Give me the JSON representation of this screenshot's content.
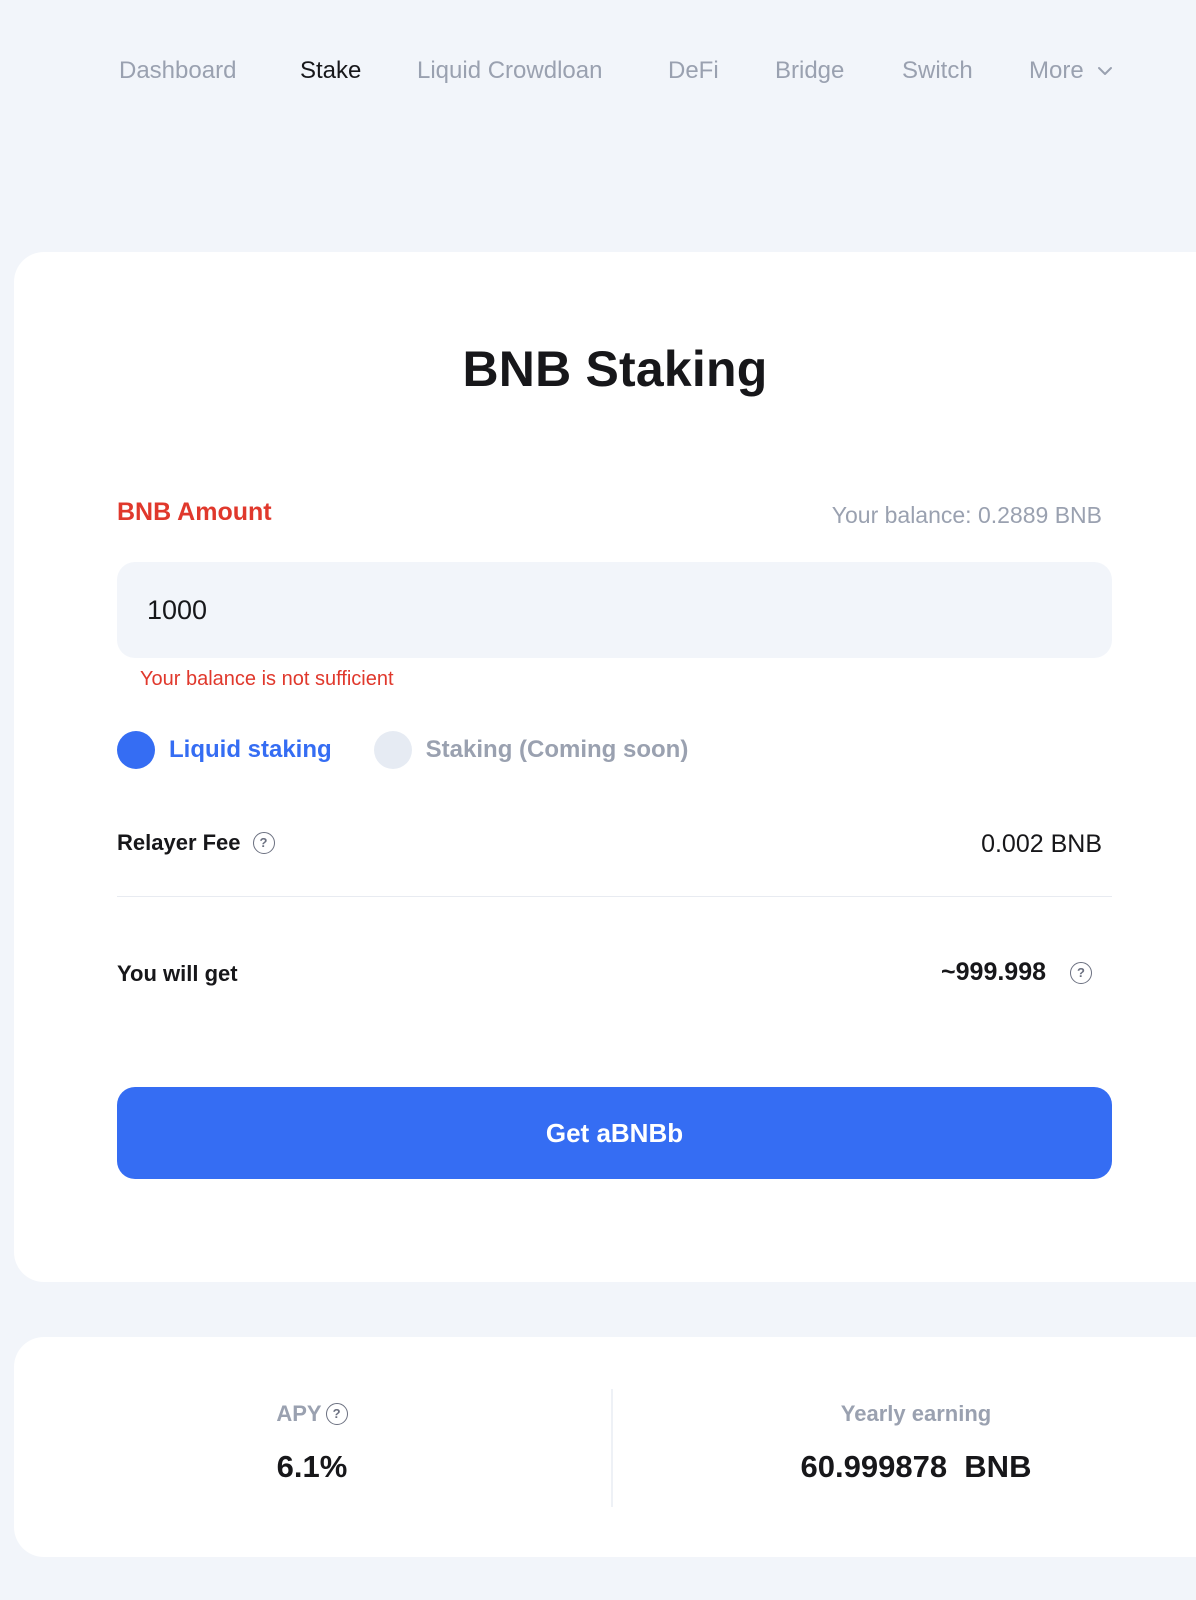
{
  "nav": {
    "items": [
      {
        "label": "Dashboard",
        "active": false
      },
      {
        "label": "Stake",
        "active": true
      },
      {
        "label": "Liquid Crowdloan",
        "active": false
      },
      {
        "label": "DeFi",
        "active": false
      },
      {
        "label": "Bridge",
        "active": false
      },
      {
        "label": "Switch",
        "active": false
      },
      {
        "label": "More",
        "active": false
      }
    ]
  },
  "staking": {
    "title": "BNB Staking",
    "amount_label": "BNB Amount",
    "balance_text": "Your balance: 0.2889 BNB",
    "amount_value": "1000",
    "error_text": "Your balance is not sufficient",
    "options": [
      {
        "label": "Liquid staking",
        "selected": true
      },
      {
        "label": "Staking (Coming soon)",
        "selected": false
      }
    ],
    "fee_label": "Relayer Fee",
    "fee_value": "0.002 BNB",
    "get_label": "You will get",
    "get_value": "~999.998",
    "help_glyph": "?",
    "cta_label": "Get aBNBb"
  },
  "stats": {
    "apy_label": "APY",
    "apy_value": "6.1%",
    "yearly_label": "Yearly earning",
    "yearly_value": "60.999878  BNB"
  },
  "colors": {
    "accent": "#356df3",
    "error": "#e0382c",
    "muted": "#9aa1b0",
    "background": "#f2f5fa"
  },
  "icons": {
    "more": "chevron-down-icon",
    "help": "help-circle-icon"
  }
}
